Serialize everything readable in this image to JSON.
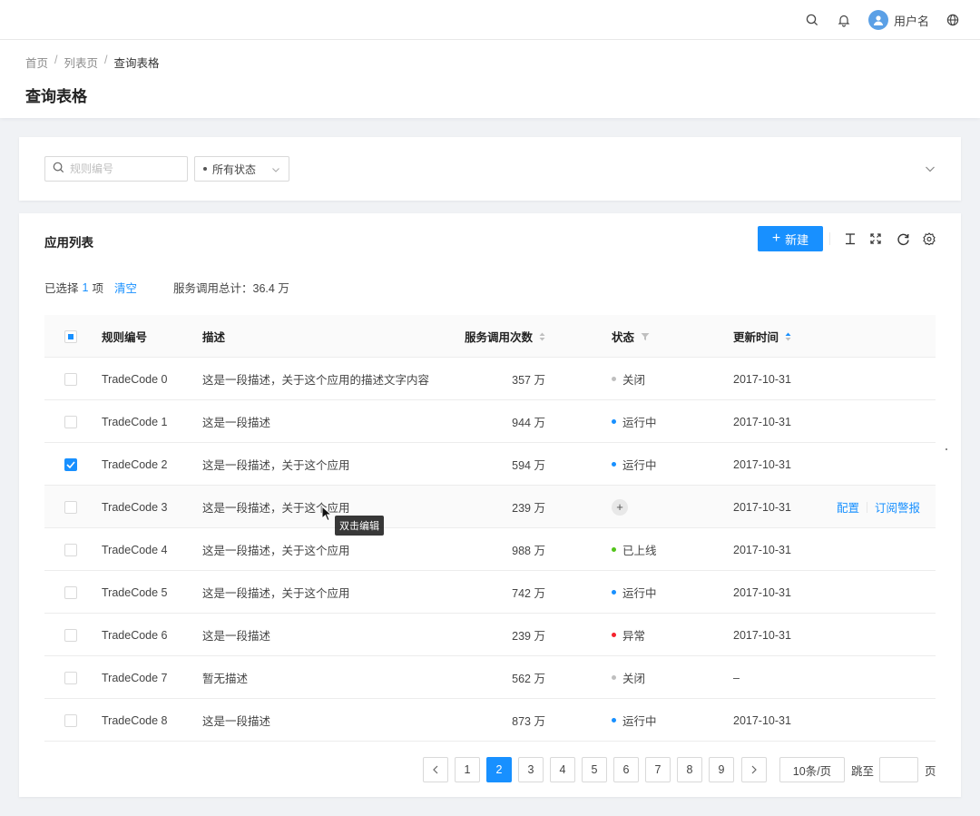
{
  "header": {
    "username": "用户名",
    "icons": [
      "search-icon",
      "bell-icon",
      "avatar",
      "globe-icon"
    ]
  },
  "breadcrumb": {
    "items": [
      "首页",
      "列表页",
      "查询表格"
    ],
    "separator": "/"
  },
  "page_title": "查询表格",
  "filters": {
    "code_placeholder": "规则编号",
    "code_value": "",
    "status_value": "所有状态"
  },
  "table_card": {
    "title": "应用列表",
    "new_button": "新建",
    "toolbar_icons": [
      "density-icon",
      "fullscreen-icon",
      "reload-icon",
      "settings-icon"
    ],
    "selection": {
      "prefix": "已选择",
      "count": "1",
      "suffix": "项",
      "clear": "清空",
      "total_label": "服务调用总计：",
      "total_value": "36.4 万"
    },
    "columns": [
      "规则编号",
      "描述",
      "服务调用次数",
      "状态",
      "更新时间"
    ],
    "rows": [
      {
        "code": "TradeCode 0",
        "desc": "这是一段描述，关于这个应用的描述文字内容",
        "calls": "357 万",
        "status": "关闭",
        "status_color": "#bfbfbf",
        "time": "2017-10-31",
        "checked": false
      },
      {
        "code": "TradeCode 1",
        "desc": "这是一段描述",
        "calls": "944 万",
        "status": "运行中",
        "status_color": "#1890ff",
        "time": "2017-10-31",
        "checked": false
      },
      {
        "code": "TradeCode 2",
        "desc": "这是一段描述，关于这个应用",
        "calls": "594 万",
        "status": "运行中",
        "status_color": "#1890ff",
        "time": "2017-10-31",
        "checked": true
      },
      {
        "code": "TradeCode 3",
        "desc": "这是一段描述，关于这个应用",
        "calls": "239 万",
        "status": "",
        "status_color": "",
        "time": "2017-10-31",
        "checked": false,
        "hover": true,
        "ops": [
          "配置",
          "订阅警报"
        ]
      },
      {
        "code": "TradeCode 4",
        "desc": "这是一段描述，关于这个应用",
        "calls": "988 万",
        "status": "已上线",
        "status_color": "#52c41a",
        "time": "2017-10-31",
        "checked": false
      },
      {
        "code": "TradeCode 5",
        "desc": "这是一段描述，关于这个应用",
        "calls": "742 万",
        "status": "运行中",
        "status_color": "#1890ff",
        "time": "2017-10-31",
        "checked": false
      },
      {
        "code": "TradeCode 6",
        "desc": "这是一段描述",
        "calls": "239 万",
        "status": "异常",
        "status_color": "#f5222d",
        "time": "2017-10-31",
        "checked": false
      },
      {
        "code": "TradeCode 7",
        "desc": "暂无描述",
        "calls": "562 万",
        "status": "关闭",
        "status_color": "#bfbfbf",
        "time": "–",
        "checked": false
      },
      {
        "code": "TradeCode 8",
        "desc": "这是一段描述",
        "calls": "873 万",
        "status": "运行中",
        "status_color": "#1890ff",
        "time": "2017-10-31",
        "checked": false
      }
    ],
    "tooltip": "双击编辑"
  },
  "pagination": {
    "pages": [
      "1",
      "2",
      "3",
      "4",
      "5",
      "6",
      "7",
      "8",
      "9"
    ],
    "current": "2",
    "page_size": "10条/页",
    "jump_label": "跳至",
    "jump_unit": "页"
  },
  "colors": {
    "accent": "#1890ff"
  }
}
